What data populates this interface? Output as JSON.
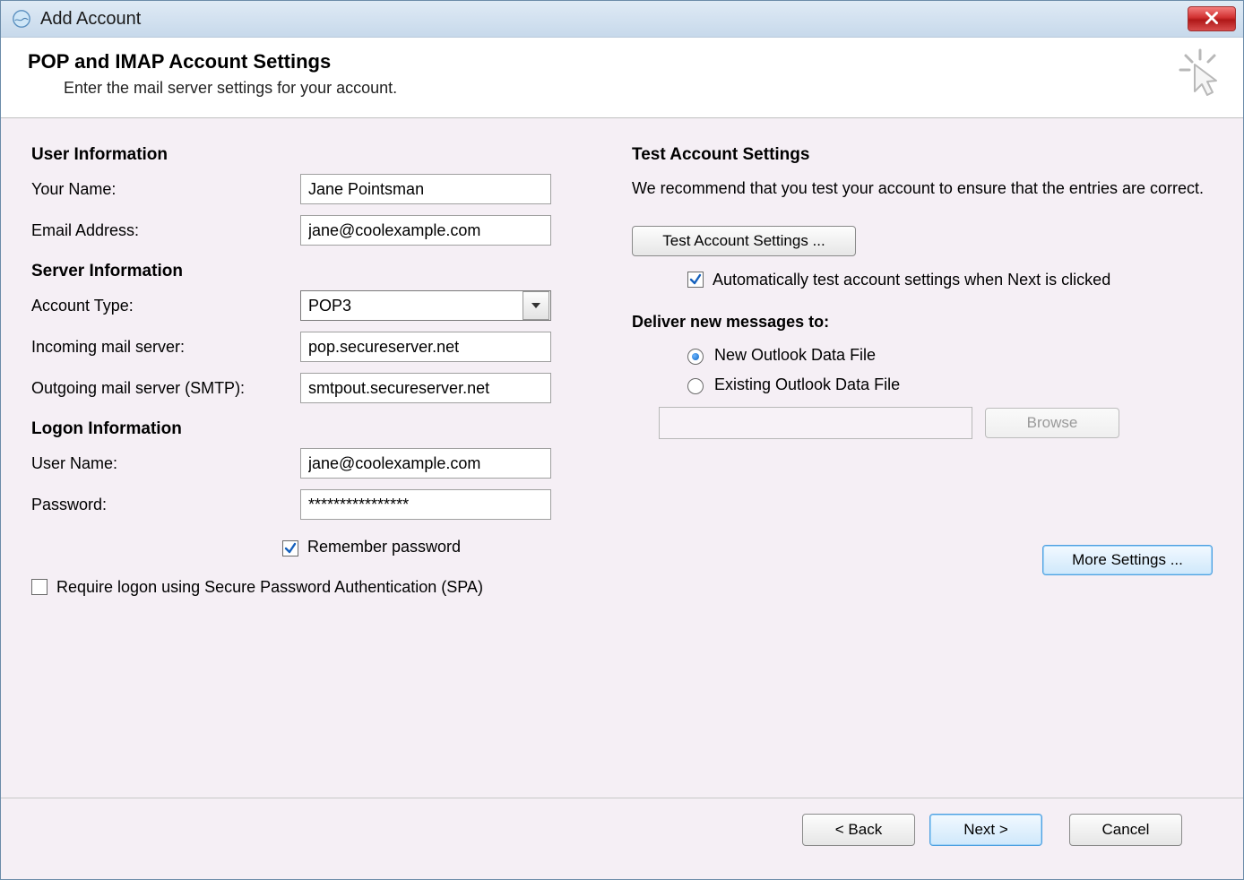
{
  "window": {
    "title": "Add Account"
  },
  "header": {
    "title": "POP and IMAP Account Settings",
    "subtitle": "Enter the mail server settings for your account."
  },
  "sections": {
    "user_info": "User Information",
    "server_info": "Server Information",
    "logon_info": "Logon Information",
    "test_settings": "Test Account Settings"
  },
  "labels": {
    "your_name": "Your Name:",
    "email": "Email Address:",
    "account_type": "Account Type:",
    "incoming": "Incoming mail server:",
    "outgoing": "Outgoing mail server (SMTP):",
    "username": "User Name:",
    "password": "Password:",
    "remember": "Remember password",
    "spa": "Require logon using Secure Password Authentication (SPA)",
    "test_desc": "We recommend that you test your account to ensure that the entries are correct.",
    "auto_test": "Automatically test account settings when Next is clicked",
    "deliver": "Deliver new messages to:",
    "new_pst": "New Outlook Data File",
    "existing_pst": "Existing Outlook Data File"
  },
  "values": {
    "your_name": "Jane Pointsman",
    "email": "jane@coolexample.com",
    "account_type": "POP3",
    "incoming": "pop.secureserver.net",
    "outgoing": "smtpout.secureserver.net",
    "username": "jane@coolexample.com",
    "password": "****************",
    "remember_checked": true,
    "spa_checked": false,
    "auto_test_checked": true,
    "deliver_selected": "new",
    "existing_path": ""
  },
  "buttons": {
    "test": "Test Account Settings ...",
    "browse": "Browse",
    "more": "More Settings ...",
    "back": "<  Back",
    "next": "Next  >",
    "cancel": "Cancel"
  }
}
